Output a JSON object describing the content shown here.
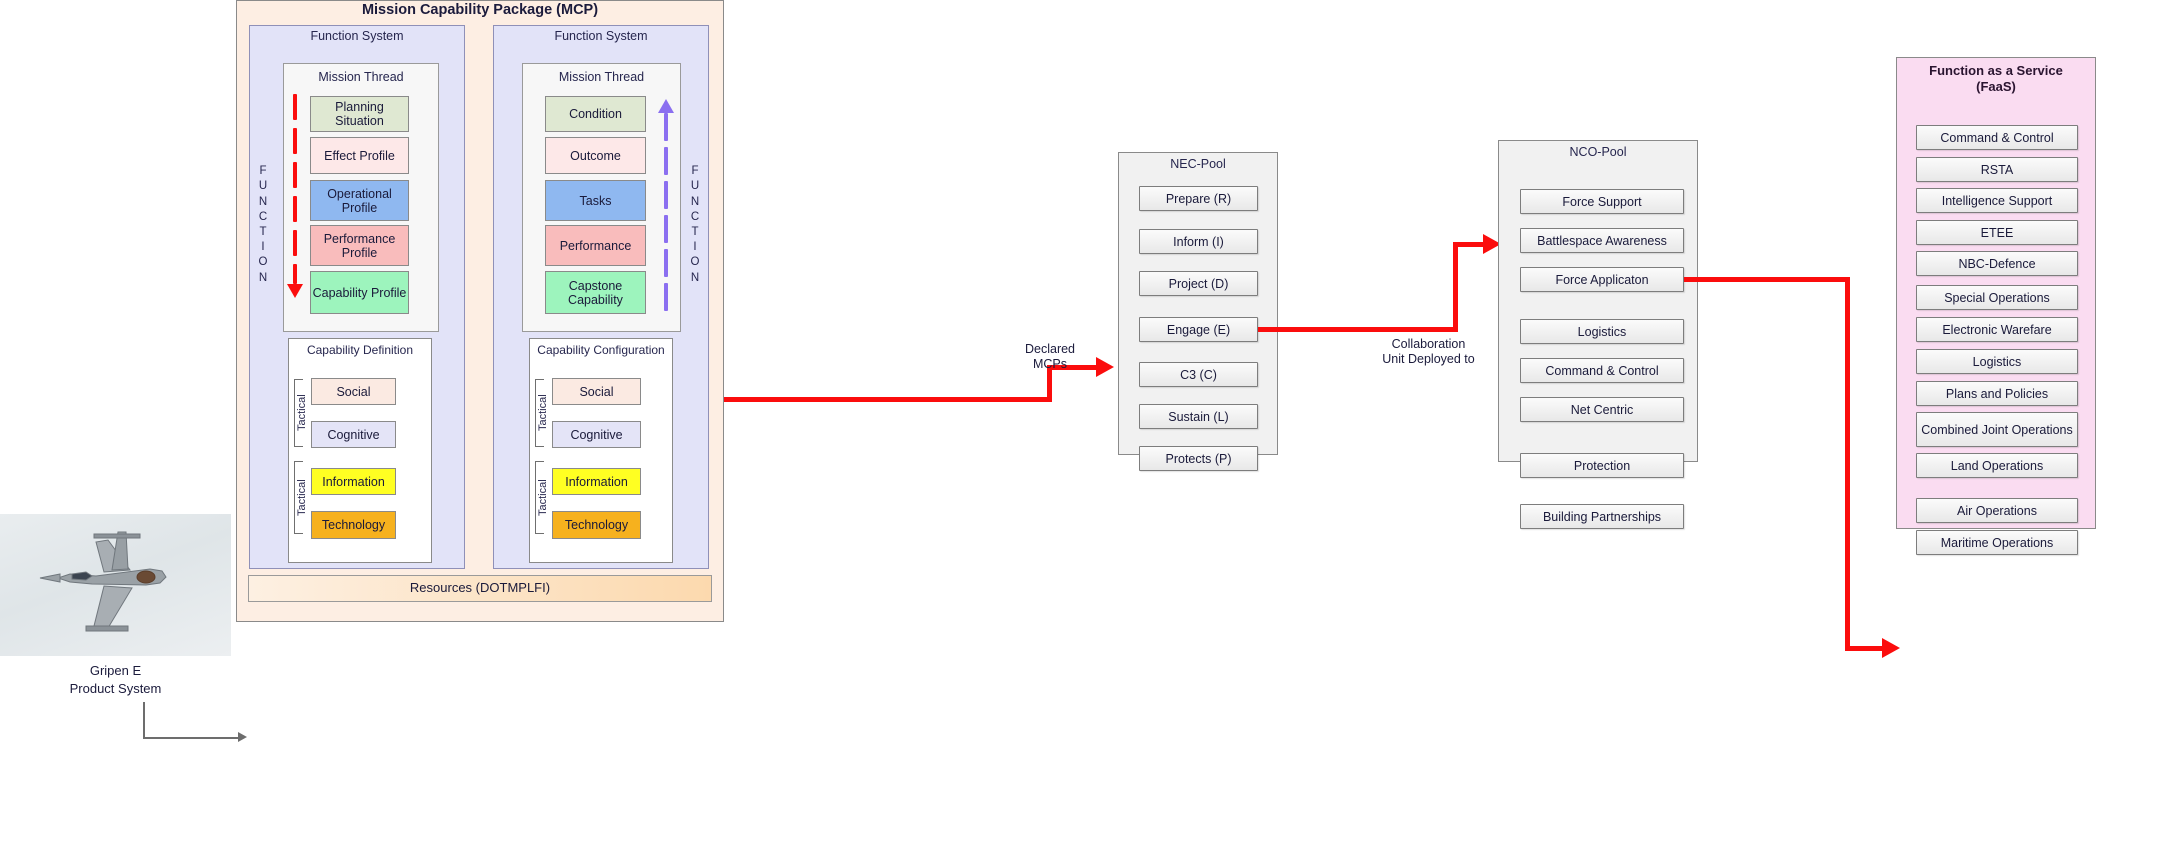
{
  "mcp": {
    "title": "Mission Capability Package (MCP)",
    "function_system_label": "Function System",
    "mission_thread_label": "Mission Thread",
    "function_word": "FUNCTION",
    "resources_label": "Resources (DOTMPLFI)",
    "tactical_label": "Tactical",
    "thread_left": {
      "items": [
        "Planning Situation",
        "Effect Profile",
        "Operational Profile",
        "Performance Profile",
        "Capability Profile"
      ]
    },
    "thread_right": {
      "items": [
        "Condition",
        "Outcome",
        "Tasks",
        "Performance",
        "Capstone Capability"
      ]
    },
    "capability_definition": {
      "title": "Capability Definition",
      "items": [
        "Social",
        "Cognitive",
        "Information",
        "Technology"
      ]
    },
    "capability_configuration": {
      "title": "Capability Configuration",
      "items": [
        "Social",
        "Cognitive",
        "Information",
        "Technology"
      ]
    }
  },
  "product": {
    "caption_line1": "Gripen E",
    "caption_line2": "Product System"
  },
  "nec_pool": {
    "title": "NEC-Pool",
    "items": [
      "Prepare (R)",
      "Inform (I)",
      "Project (D)",
      "Engage (E)",
      "C3 (C)",
      "Sustain (L)",
      "Protects (P)"
    ],
    "highlighted": "Engage (E)"
  },
  "nco_pool": {
    "title": "NCO-Pool",
    "items": [
      "Force Support",
      "Battlespace Awareness",
      "Force Applicaton",
      "Logistics",
      "Command & Control",
      "Net Centric",
      "Protection",
      "Building Partnerships"
    ],
    "highlighted": "Force Applicaton"
  },
  "faas": {
    "title_line1": "Function as a Service",
    "title_line2": "(FaaS)",
    "items": [
      "Command & Control",
      "RSTA",
      "Intelligence Support",
      "ETEE",
      "NBC-Defence",
      "Special Operations",
      "Electronic Warefare",
      "Logistics",
      "Plans and Policies",
      "Combined Joint Operations",
      "Land Operations",
      "Air Operations",
      "Maritime Operations"
    ],
    "highlighted": "Air Operations"
  },
  "connectors": {
    "declared_mcps_line1": "Declared",
    "declared_mcps_line2": "MCPs",
    "collaboration_line1": "Collaboration",
    "collaboration_line2": "Unit Deployed to"
  },
  "colors": {
    "accent_red": "#fb0d0d",
    "accent_violet": "#8b6ff0",
    "mcp_bg": "#fdeee3",
    "function_system_bg": "#e2e3f8",
    "faas_bg": "#fadcf1",
    "pool_bg": "#f1f1f1"
  }
}
